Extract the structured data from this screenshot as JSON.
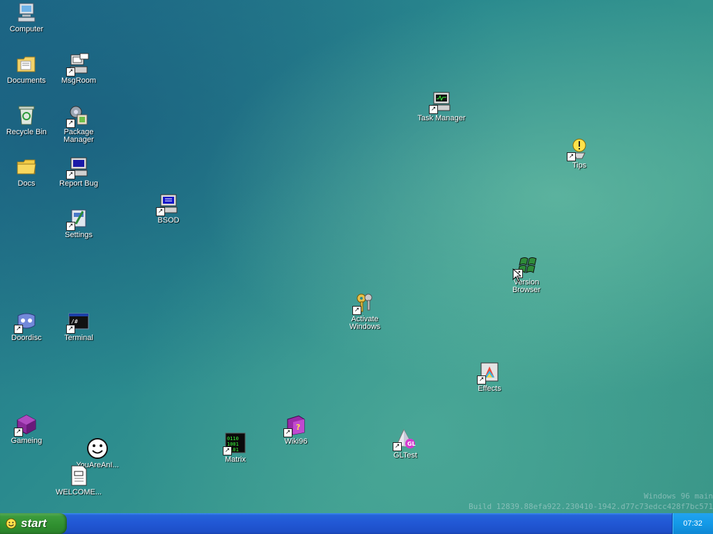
{
  "desktop": {
    "icons": [
      {
        "label": "Computer",
        "icon": "computer-icon"
      },
      {
        "label": "Documents",
        "icon": "documents-folder-icon"
      },
      {
        "label": "MsgRoom",
        "icon": "msgroom-icon"
      },
      {
        "label": "Recycle Bin",
        "icon": "recycle-bin-icon"
      },
      {
        "label": "Package Manager",
        "icon": "package-manager-icon"
      },
      {
        "label": "Docs",
        "icon": "folder-icon"
      },
      {
        "label": "Report Bug",
        "icon": "report-bug-icon"
      },
      {
        "label": "Settings",
        "icon": "settings-icon"
      },
      {
        "label": "BSOD",
        "icon": "bsod-icon"
      },
      {
        "label": "Task Manager",
        "icon": "task-manager-icon"
      },
      {
        "label": "Tips",
        "icon": "tips-icon"
      },
      {
        "label": "Version Browser",
        "icon": "windows-flag-icon"
      },
      {
        "label": "Activate Windows",
        "icon": "keys-icon"
      },
      {
        "label": "Doordisc",
        "icon": "doordisc-icon"
      },
      {
        "label": "Terminal",
        "icon": "terminal-icon"
      },
      {
        "label": "Effects",
        "icon": "effects-icon"
      },
      {
        "label": "Gameing",
        "icon": "game-cube-icon"
      },
      {
        "label": "YouAreAnI...",
        "icon": "smiley-face-icon"
      },
      {
        "label": "Matrix",
        "icon": "matrix-icon"
      },
      {
        "label": "Wiki96",
        "icon": "help-book-icon"
      },
      {
        "label": "GLTest",
        "icon": "gl-pyramid-icon"
      },
      {
        "label": "WELCOME...",
        "icon": "text-file-icon"
      }
    ]
  },
  "watermark": {
    "line1": "Windows 96 main",
    "line2": "Build 12839.88efa922.230410-1942.d77c73edcc428f7bc571"
  },
  "taskbar": {
    "start_label": "start",
    "clock": "07:32"
  },
  "colors": {
    "desktop": "#2a8a8e",
    "taskbar": "#2157d4",
    "start_button": "#2f8f2f",
    "tray": "#139ae8"
  }
}
